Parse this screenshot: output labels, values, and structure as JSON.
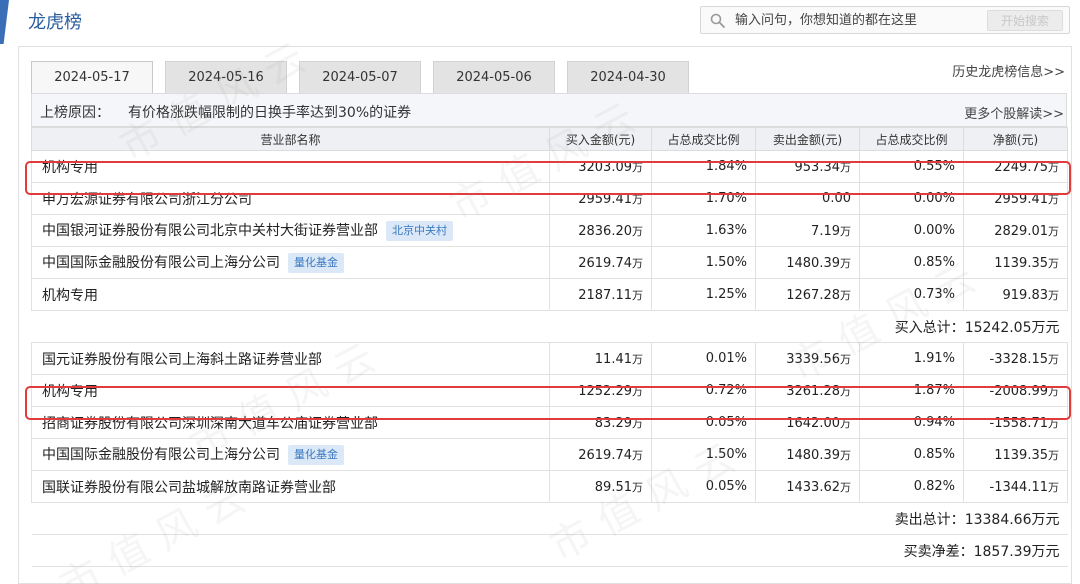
{
  "app": {
    "title": "龙虎榜"
  },
  "search": {
    "placeholder": "输入问句，你想知道的都在这里",
    "button_label": "开始搜索"
  },
  "tabs": [
    {
      "label": "2024-05-17",
      "active": true
    },
    {
      "label": "2024-05-16",
      "active": false
    },
    {
      "label": "2024-05-07",
      "active": false
    },
    {
      "label": "2024-05-06",
      "active": false
    },
    {
      "label": "2024-04-30",
      "active": false
    }
  ],
  "history_link": "历史龙虎榜信息>>",
  "reason": {
    "label": "上榜原因：",
    "text": "有价格涨跌幅限制的日换手率达到30%的证券"
  },
  "more_link": "更多个股解读>>",
  "table": {
    "columns": [
      "营业部名称",
      "买入金额(元)",
      "占总成交比例",
      "卖出金额(元)",
      "占总成交比例",
      "净额(元)"
    ],
    "buy_rows": [
      {
        "name": "机构专用",
        "tag": "",
        "buy": "3203.09",
        "buy_unit": "万",
        "buy_pct": "1.84%",
        "sell": "953.34",
        "sell_unit": "万",
        "sell_pct": "0.55%",
        "net": "2249.75",
        "net_unit": "万"
      },
      {
        "name": "申万宏源证券有限公司浙江分公司",
        "tag": "",
        "buy": "2959.41",
        "buy_unit": "万",
        "buy_pct": "1.70%",
        "sell": "0.00",
        "sell_unit": "",
        "sell_pct": "0.00%",
        "net": "2959.41",
        "net_unit": "万"
      },
      {
        "name": "中国银河证券股份有限公司北京中关村大街证券营业部",
        "tag": "北京中关村",
        "buy": "2836.20",
        "buy_unit": "万",
        "buy_pct": "1.63%",
        "sell": "7.19",
        "sell_unit": "万",
        "sell_pct": "0.00%",
        "net": "2829.01",
        "net_unit": "万"
      },
      {
        "name": "中国国际金融股份有限公司上海分公司",
        "tag": "量化基金",
        "buy": "2619.74",
        "buy_unit": "万",
        "buy_pct": "1.50%",
        "sell": "1480.39",
        "sell_unit": "万",
        "sell_pct": "0.85%",
        "net": "1139.35",
        "net_unit": "万"
      },
      {
        "name": "机构专用",
        "tag": "",
        "buy": "2187.11",
        "buy_unit": "万",
        "buy_pct": "1.25%",
        "sell": "1267.28",
        "sell_unit": "万",
        "sell_pct": "0.73%",
        "net": "919.83",
        "net_unit": "万"
      }
    ],
    "buy_total": {
      "label": "买入总计：",
      "value": "15242.05万元"
    },
    "sell_rows": [
      {
        "name": "国元证券股份有限公司上海斜土路证券营业部",
        "tag": "",
        "buy": "11.41",
        "buy_unit": "万",
        "buy_pct": "0.01%",
        "sell": "3339.56",
        "sell_unit": "万",
        "sell_pct": "1.91%",
        "net": "-3328.15",
        "net_unit": "万"
      },
      {
        "name": "机构专用",
        "tag": "",
        "buy": "1252.29",
        "buy_unit": "万",
        "buy_pct": "0.72%",
        "sell": "3261.28",
        "sell_unit": "万",
        "sell_pct": "1.87%",
        "net": "-2008.99",
        "net_unit": "万"
      },
      {
        "name": "招商证券股份有限公司深圳深南大道车公庙证券营业部",
        "tag": "",
        "buy": "83.29",
        "buy_unit": "万",
        "buy_pct": "0.05%",
        "sell": "1642.00",
        "sell_unit": "万",
        "sell_pct": "0.94%",
        "net": "-1558.71",
        "net_unit": "万"
      },
      {
        "name": "中国国际金融股份有限公司上海分公司",
        "tag": "量化基金",
        "buy": "2619.74",
        "buy_unit": "万",
        "buy_pct": "1.50%",
        "sell": "1480.39",
        "sell_unit": "万",
        "sell_pct": "0.85%",
        "net": "1139.35",
        "net_unit": "万"
      },
      {
        "name": "国联证券股份有限公司盐城解放南路证券营业部",
        "tag": "",
        "buy": "89.51",
        "buy_unit": "万",
        "buy_pct": "0.05%",
        "sell": "1433.62",
        "sell_unit": "万",
        "sell_pct": "0.82%",
        "net": "-1344.11",
        "net_unit": "万"
      }
    ],
    "sell_total": {
      "label": "卖出总计：",
      "value": "13384.66万元"
    },
    "net_total": {
      "label": "买卖净差：",
      "value": "1857.39万元"
    }
  },
  "watermark_text": "市值风云",
  "colors": {
    "accent": "#3a6fb7",
    "highlight": "#e23b3b",
    "tag_bg": "#dbe8f7",
    "tag_text": "#3b79c2"
  }
}
